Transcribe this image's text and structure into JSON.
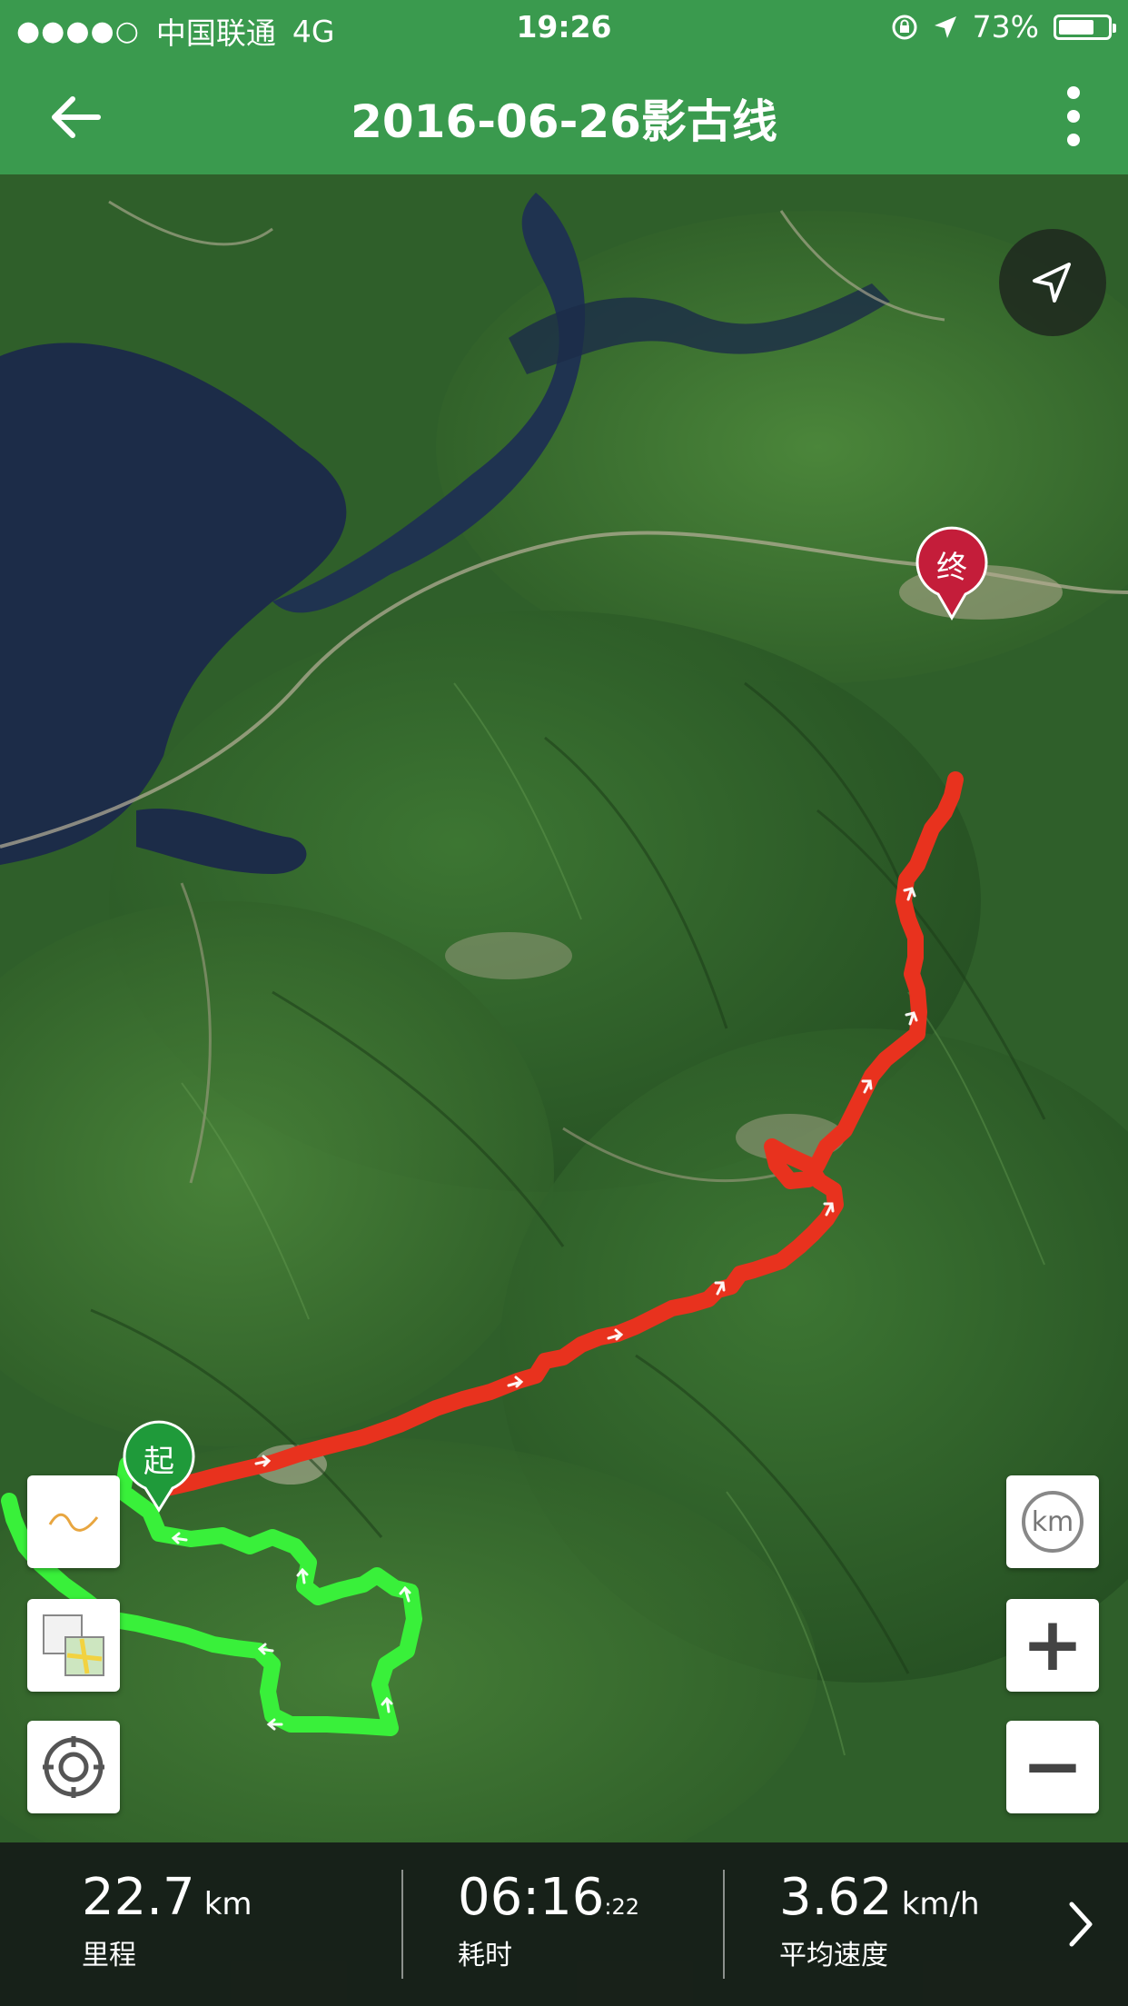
{
  "status_bar": {
    "signal_dots": "●●●●○",
    "carrier": "中国联通",
    "network": "4G",
    "time": "19:26",
    "battery_percent": "73%",
    "battery_level": 0.73
  },
  "header": {
    "title": "2016-06-26影古线",
    "back_icon": "arrow-left-icon",
    "menu_icon": "vertical-ellipsis-icon"
  },
  "map": {
    "start_marker_label": "起",
    "end_marker_label": "终",
    "track_color_outbound": "#e8321e",
    "track_color_return": "#39f03a",
    "start_marker_color": "#1f9a3a",
    "end_marker_color": "#c41d3a",
    "controls": {
      "locate_icon": "navigation-arrow-icon",
      "altitude_icon": "wave-line-icon",
      "layers_icon": "map-layers-icon",
      "recenter_icon": "target-ring-icon",
      "unit_label": "km",
      "zoom_in_label": "+",
      "zoom_out_label": "−"
    }
  },
  "stats": {
    "distance_value": "22.7",
    "distance_unit": "km",
    "distance_label": "里程",
    "duration_value": "06:16",
    "duration_seconds": ":22",
    "duration_label": "耗时",
    "speed_value": "3.62",
    "speed_unit": "km/h",
    "speed_label": "平均速度"
  },
  "colors": {
    "header_green": "#3a9a4e",
    "stats_background": "#161c18"
  }
}
